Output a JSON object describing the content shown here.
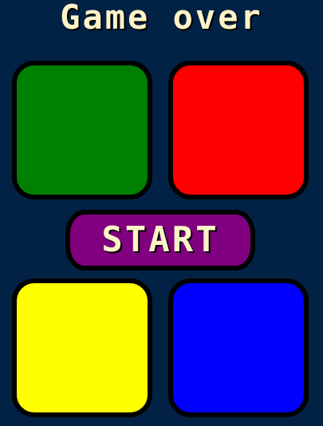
{
  "header": {
    "title": "Game over"
  },
  "controls": {
    "start_label": "START"
  },
  "pads": {
    "green": "#008000",
    "red": "#ff0000",
    "yellow": "#ffff00",
    "blue": "#0000ff"
  },
  "colors": {
    "background": "#012245",
    "text": "#fef3c7",
    "start_button": "#800080",
    "outline": "#000000"
  }
}
